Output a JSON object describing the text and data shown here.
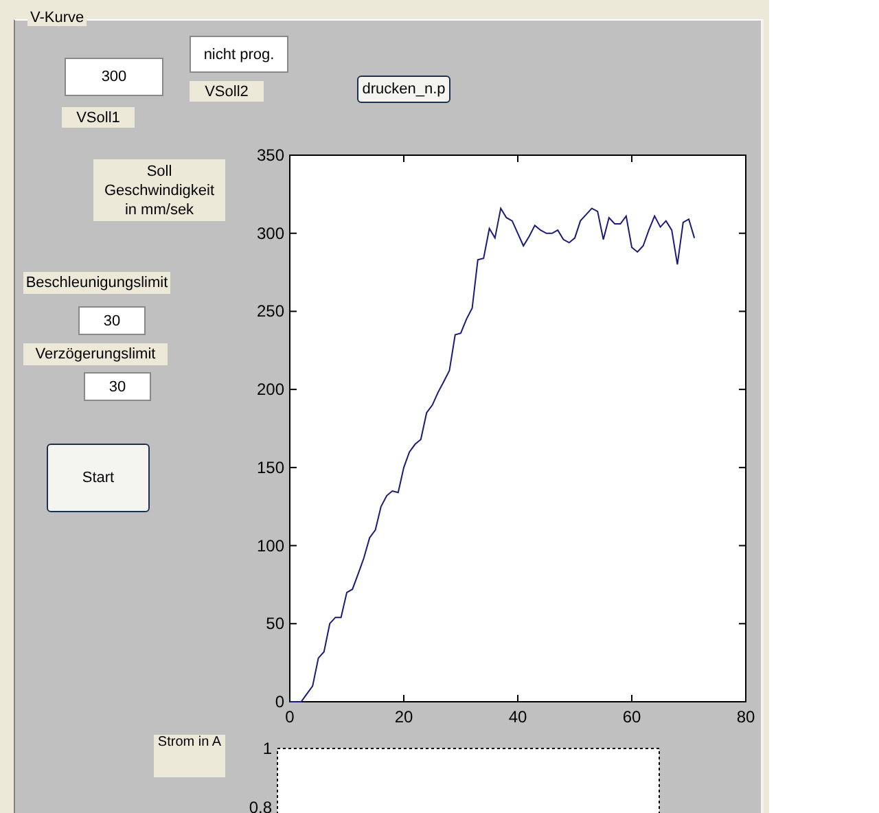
{
  "panel": {
    "title": "V-Kurve"
  },
  "vsoll1": {
    "value": "300",
    "label": "VSoll1"
  },
  "vsoll2": {
    "value": "nicht prog.",
    "label": "VSoll2"
  },
  "print_button": {
    "label": "drucken_n.p"
  },
  "speed_label": "Soll Geschwindigkeit in mm/sek",
  "acceleration": {
    "label": "Beschleunigungslimit",
    "value": "30"
  },
  "deceleration": {
    "label": "Verzögerungslimit",
    "value": "30"
  },
  "start_button": {
    "label": "Start"
  },
  "current_label": "Strom in A",
  "speed_plot": {
    "chart_data": {
      "type": "line",
      "xlim": [
        0,
        80
      ],
      "ylim": [
        0,
        350
      ],
      "xticks": [
        0,
        20,
        40,
        60,
        80
      ],
      "yticks": [
        0,
        50,
        100,
        150,
        200,
        250,
        300,
        350
      ],
      "x": [
        0,
        1,
        2,
        3,
        4,
        5,
        6,
        7,
        8,
        9,
        10,
        11,
        12,
        13,
        14,
        15,
        16,
        17,
        18,
        19,
        20,
        21,
        22,
        23,
        24,
        25,
        26,
        27,
        28,
        29,
        30,
        31,
        32,
        33,
        34,
        35,
        36,
        37,
        38,
        39,
        40,
        41,
        42,
        43,
        44,
        45,
        46,
        47,
        48,
        49,
        50,
        51,
        52,
        53,
        54,
        55,
        56,
        57,
        58,
        59,
        60,
        61,
        62,
        63,
        64,
        65,
        66,
        67,
        68,
        69,
        70,
        71
      ],
      "series": [
        {
          "color": "#1a1a7a",
          "values": [
            0,
            0,
            0,
            5,
            10,
            28,
            32,
            50,
            54,
            54,
            70,
            72,
            82,
            92,
            105,
            110,
            125,
            132,
            135,
            134,
            150,
            160,
            165,
            168,
            185,
            190,
            198,
            205,
            212,
            235,
            236,
            245,
            252,
            283,
            284,
            303,
            297,
            316,
            310,
            308,
            300,
            292,
            298,
            305,
            302,
            300,
            300,
            302,
            296,
            294,
            297,
            308,
            312,
            316,
            314,
            296,
            310,
            306,
            306,
            311,
            291,
            288,
            292,
            302,
            311,
            304,
            308,
            302,
            280,
            307,
            309,
            297
          ]
        }
      ]
    }
  },
  "current_plot": {
    "yticks": [
      "1",
      "0.8"
    ]
  }
}
